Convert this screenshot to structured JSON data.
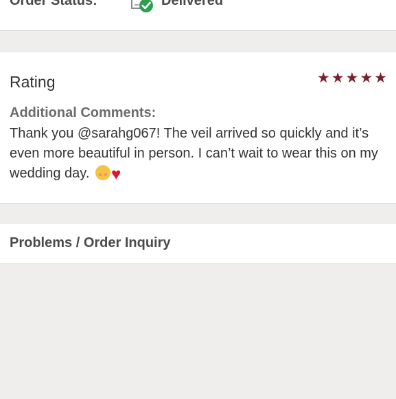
{
  "order": {
    "status_label": "Order Status:",
    "status_value": "Delivered",
    "status_icon": "package-delivered-icon",
    "status_color": "#2e9e4f"
  },
  "rating": {
    "title": "Rating",
    "stars": 5,
    "star_color": "#7a1f2b",
    "comments_heading": "Additional Comments:",
    "comments_text": "Thank you @sarahg067! The veil arrived so quickly and it’s even more beautiful in person. I can’t wait to wear this on my wedding day.",
    "emojis": [
      "smiling-face-with-hearts-emoji",
      "red-heart-emoji"
    ]
  },
  "inquiry": {
    "label": "Problems / Order Inquiry"
  }
}
